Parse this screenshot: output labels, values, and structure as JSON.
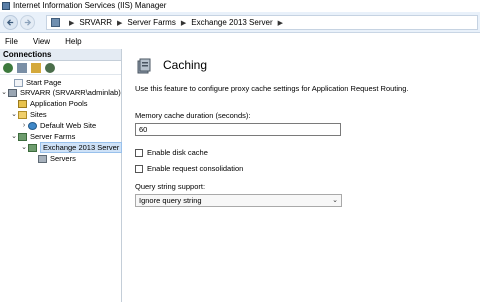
{
  "window": {
    "title": "Internet Information Services (IIS) Manager"
  },
  "address": {
    "crumbs": [
      "SRVARR",
      "Server Farms",
      "Exchange 2013 Server"
    ]
  },
  "menu": {
    "items": [
      "File",
      "View",
      "Help"
    ]
  },
  "connections": {
    "header": "Connections",
    "tree": [
      {
        "label": "Start Page",
        "icon": "start-page-icon"
      },
      {
        "label": "SRVARR (SRVARR\\adminlab)",
        "icon": "server-icon"
      },
      {
        "label": "Application Pools",
        "icon": "app-pools-icon"
      },
      {
        "label": "Sites",
        "icon": "folder-icon"
      },
      {
        "label": "Default Web Site",
        "icon": "globe-icon"
      },
      {
        "label": "Server Farms",
        "icon": "server-farms-icon"
      },
      {
        "label": "Exchange 2013 Server",
        "icon": "server-farm-icon",
        "selected": true
      },
      {
        "label": "Servers",
        "icon": "servers-icon"
      }
    ]
  },
  "feature": {
    "title": "Caching",
    "description": "Use this feature to configure proxy cache settings for Application Request Routing.",
    "memory_label": "Memory cache duration (seconds):",
    "memory_value": "60",
    "enable_disk_cache": "Enable disk cache",
    "enable_request_consolidation": "Enable request consolidation",
    "query_label": "Query string support:",
    "query_value": "Ignore query string"
  },
  "colors": {
    "selection": "#cfe2f7",
    "pane_header": "#e4ebf3",
    "address_bar": "#e9f1fa"
  }
}
